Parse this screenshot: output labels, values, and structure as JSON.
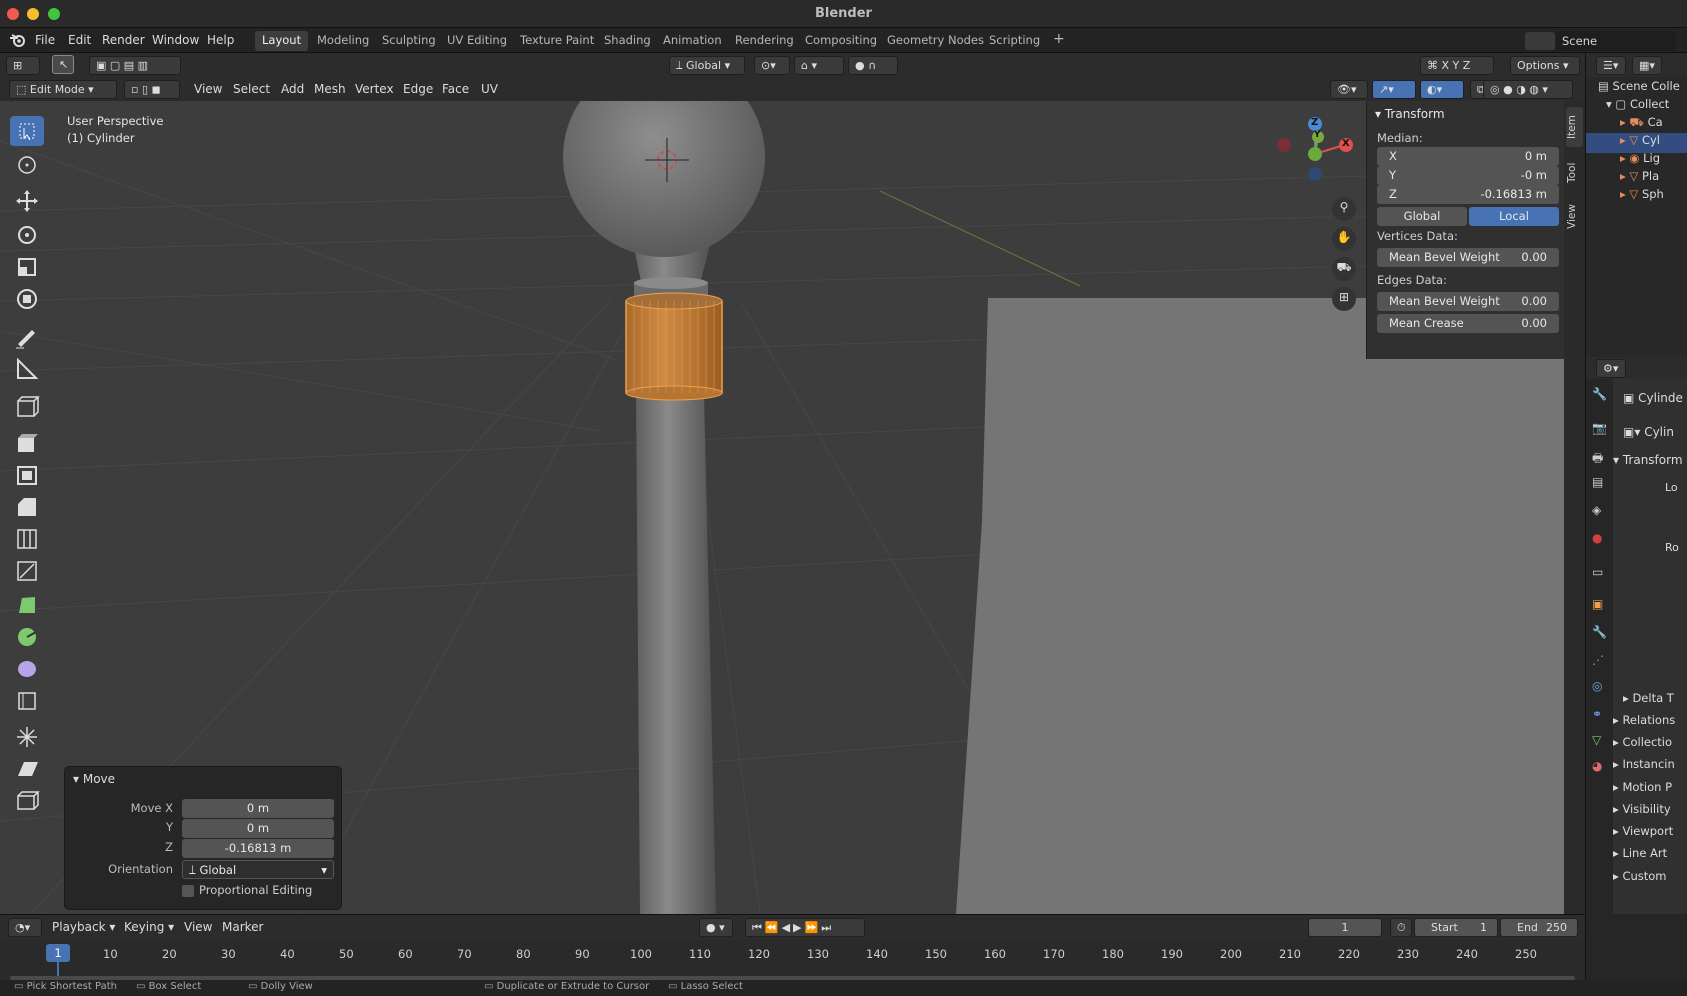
{
  "window": {
    "title": "Blender"
  },
  "menubar": {
    "items": [
      "File",
      "Edit",
      "Render",
      "Window",
      "Help"
    ],
    "workspaces": [
      "Layout",
      "Modeling",
      "Sculpting",
      "UV Editing",
      "Texture Paint",
      "Shading",
      "Animation",
      "Rendering",
      "Compositing",
      "Geometry Nodes",
      "Scripting"
    ],
    "active_workspace": "Layout",
    "add_tab": "+",
    "scene": "Scene"
  },
  "tool_header": {
    "orientation": "Global",
    "options": "Options"
  },
  "edit_header": {
    "mode": "Edit Mode",
    "menus": [
      "View",
      "Select",
      "Add",
      "Mesh",
      "Vertex",
      "Edge",
      "Face",
      "UV"
    ]
  },
  "viewport": {
    "overlay_title": "User Perspective",
    "overlay_object": "(1) Cylinder",
    "gizmo": {
      "z": "Z",
      "y": "Y",
      "x": "X"
    }
  },
  "npanel": {
    "section": "Transform",
    "median_label": "Median:",
    "x_label": "X",
    "x_value": "0 m",
    "y_label": "Y",
    "y_value": "-0 m",
    "z_label": "Z",
    "z_value": "-0.16813 m",
    "global_btn": "Global",
    "local_btn": "Local",
    "vertices_label": "Vertices Data:",
    "v_bevel_label": "Mean Bevel Weight",
    "v_bevel_value": "0.00",
    "edges_label": "Edges Data:",
    "e_bevel_label": "Mean Bevel Weight",
    "e_bevel_value": "0.00",
    "e_crease_label": "Mean Crease",
    "e_crease_value": "0.00",
    "tabs": [
      "Item",
      "Tool",
      "View"
    ]
  },
  "move_panel": {
    "title": "Move",
    "move_x_label": "Move X",
    "move_x_value": "0 m",
    "y_label": "Y",
    "y_value": "0 m",
    "z_label": "Z",
    "z_value": "-0.16813 m",
    "orientation_label": "Orientation",
    "orientation_value": "Global",
    "proportional_label": "Proportional Editing"
  },
  "outliner": {
    "scene_collection": "Scene Colle",
    "collection": "Collect",
    "items": [
      "Ca",
      "Cyl",
      "Lig",
      "Pla",
      "Sph"
    ]
  },
  "properties": {
    "object_name": "Cylinde",
    "data_name": "Cylin",
    "transform": "Transform",
    "location": "Lo",
    "rotation": "Ro",
    "sections": [
      "Delta T",
      "Relations",
      "Collectio",
      "Instancin",
      "Motion P",
      "Visibility",
      "Viewport",
      "Line Art",
      "Custom"
    ]
  },
  "timeline": {
    "menus": [
      "Playback",
      "Keying",
      "View",
      "Marker"
    ],
    "current_frame": "1",
    "start_label": "Start",
    "start_value": "1",
    "end_label": "End",
    "end_value": "250",
    "ticks": [
      "10",
      "20",
      "30",
      "40",
      "50",
      "60",
      "70",
      "80",
      "90",
      "100",
      "110",
      "120",
      "130",
      "140",
      "150",
      "160",
      "170",
      "180",
      "190",
      "200",
      "210",
      "220",
      "230",
      "240",
      "250"
    ],
    "playhead": "1"
  },
  "statusbar": {
    "items": [
      "Pick Shortest Path",
      "Box Select",
      "Dolly View",
      "Duplicate or Extrude to Cursor",
      "Lasso Select"
    ]
  },
  "colors": {
    "accent": "#4772b3",
    "selection": "#e8943a"
  }
}
